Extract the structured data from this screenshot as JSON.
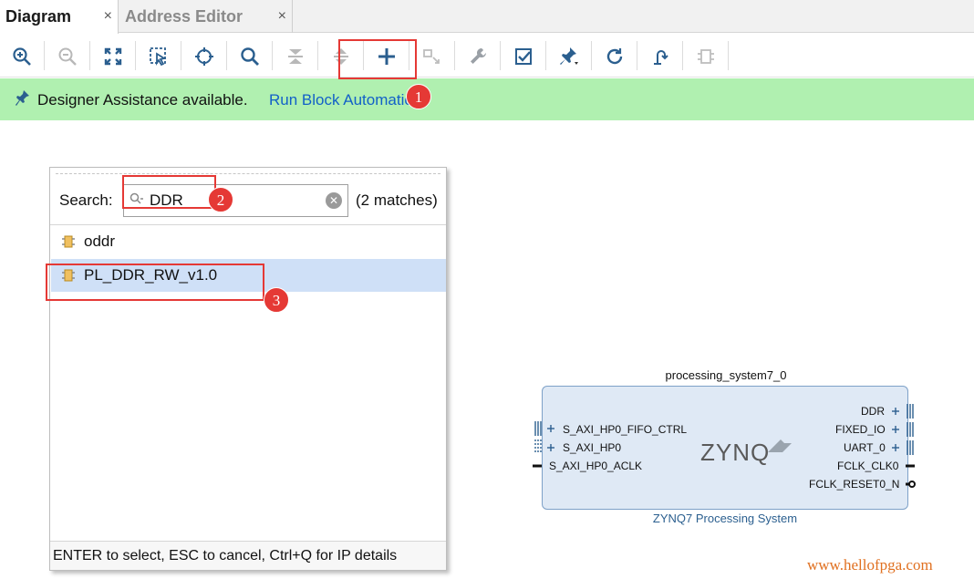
{
  "tabs": [
    {
      "label": "Diagram",
      "close": "×"
    },
    {
      "label": "Address Editor",
      "close": "×"
    }
  ],
  "toolbar": {
    "icons": [
      "zoom-in-icon",
      "zoom-out-icon",
      "fit-view-icon",
      "select-area-icon",
      "center-icon",
      "search-icon",
      "collapse-icon",
      "expand-icon",
      "add-ip-icon",
      "add-module-icon",
      "properties-icon",
      "validate-icon",
      "pin-icon",
      "refresh-icon",
      "regenerate-icon",
      "module-icon"
    ]
  },
  "banner": {
    "text": "Designer Assistance available.",
    "link": "Run Block Automation"
  },
  "popup": {
    "search_label": "Search:",
    "search_value": "DDR",
    "matches": "(2 matches)",
    "items": [
      {
        "label": "oddr"
      },
      {
        "label": "PL_DDR_RW_v1.0"
      }
    ],
    "footer": "ENTER to select, ESC to cancel, Ctrl+Q for IP details"
  },
  "annotations": [
    "1",
    "2",
    "3"
  ],
  "block": {
    "instance_name": "processing_system7_0",
    "logo": "ZYNQ",
    "subtitle": "ZYNQ7 Processing System",
    "left_ports": [
      "S_AXI_HP0_FIFO_CTRL",
      "S_AXI_HP0",
      "S_AXI_HP0_ACLK"
    ],
    "right_ports": [
      "DDR",
      "FIXED_IO",
      "UART_0",
      "FCLK_CLK0",
      "FCLK_RESET0_N"
    ]
  },
  "watermark": "www.hellofpga.com",
  "colors": {
    "banner": "#b0f0b0",
    "annotation": "#e53935",
    "selection": "#cfe0f7",
    "link": "#1260c8"
  }
}
